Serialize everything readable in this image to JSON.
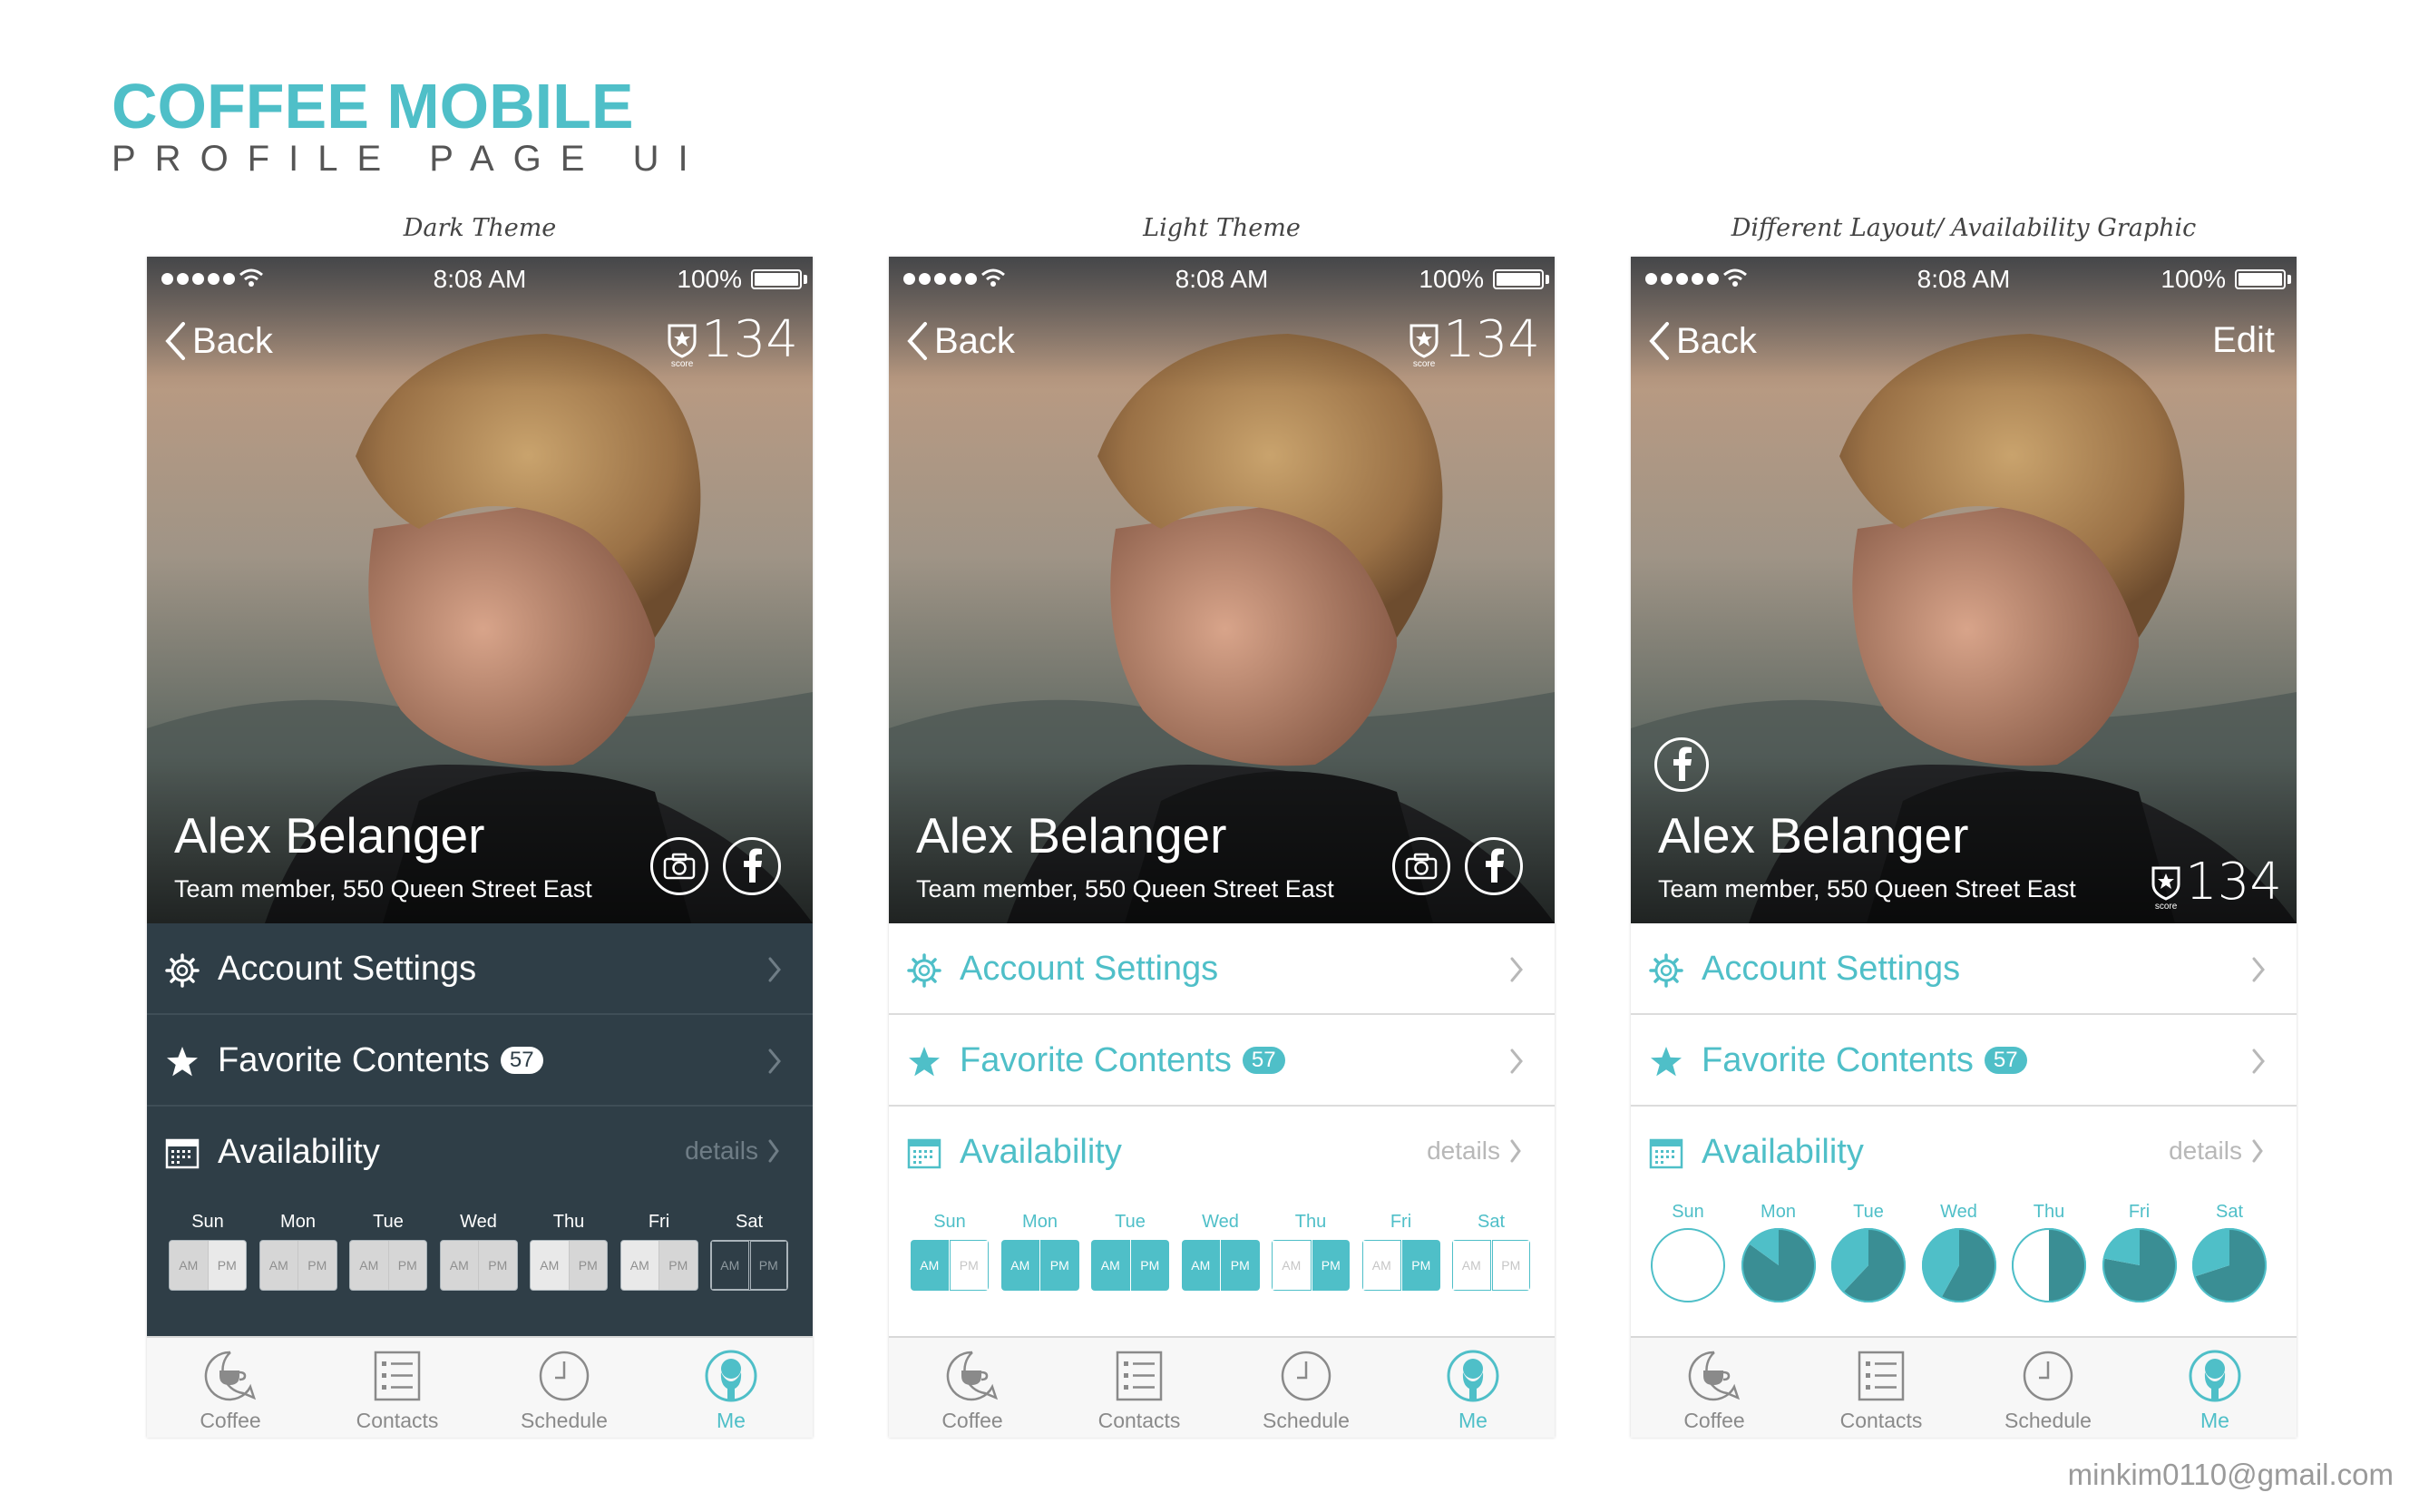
{
  "header": {
    "title": "COFFEE MOBILE",
    "subtitle": "PROFILE PAGE UI"
  },
  "captions": [
    "Dark Theme",
    "Light Theme",
    "Different Layout/ Availability Graphic"
  ],
  "footer_email": "minkim0110@gmail.com",
  "status": {
    "time": "8:08 AM",
    "battery": "100%"
  },
  "nav": {
    "back": "Back",
    "edit": "Edit"
  },
  "profile": {
    "name": "Alex Belanger",
    "role": "Team member, 550 Queen Street East",
    "score": "134",
    "score_label": "score"
  },
  "menu": {
    "account": "Account Settings",
    "favorites": "Favorite Contents",
    "favorites_count": "57",
    "availability": "Availability",
    "details": "details"
  },
  "days": [
    "Sun",
    "Mon",
    "Tue",
    "Wed",
    "Thu",
    "Fri",
    "Sat"
  ],
  "slots": {
    "am": "AM",
    "pm": "PM"
  },
  "availability": {
    "dark": [
      [
        true,
        false
      ],
      [
        true,
        true
      ],
      [
        true,
        true
      ],
      [
        true,
        true
      ],
      [
        false,
        true
      ],
      [
        false,
        true
      ],
      [
        false,
        false
      ]
    ],
    "light": [
      [
        true,
        false
      ],
      [
        true,
        true
      ],
      [
        true,
        true
      ],
      [
        true,
        true
      ],
      [
        false,
        true
      ],
      [
        false,
        true
      ],
      [
        false,
        false
      ]
    ],
    "pie_fraction": [
      0,
      0.85,
      0.62,
      0.58,
      0.5,
      0.78,
      0.7
    ]
  },
  "tabs": [
    "Coffee",
    "Contacts",
    "Schedule",
    "Me"
  ],
  "colors": {
    "accent": "#4fbfc8",
    "dark_panel": "#2f3e47",
    "dark_separator": "#3f4e57"
  }
}
